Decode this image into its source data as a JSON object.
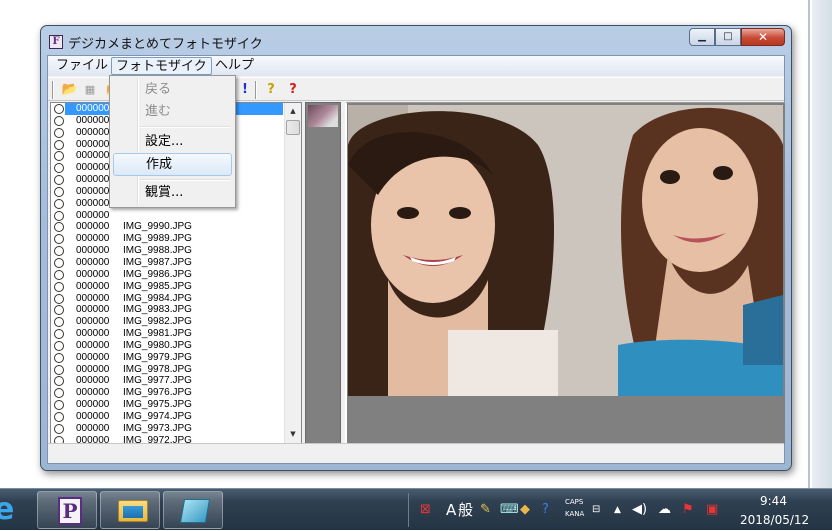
{
  "window": {
    "title": "デジカメまとめてフォトモザイク",
    "app_icon_letter": "F",
    "caption": {
      "minimize": "▁",
      "maximize": "□",
      "close": "✕"
    }
  },
  "menubar": {
    "file": "ファイル",
    "photomosaic": "フォトモザイク",
    "help": "ヘルプ"
  },
  "dropdown": {
    "back": "戻る",
    "forward": "進む",
    "settings": "設定...",
    "create": "作成",
    "view": "観賞..."
  },
  "toolbar": {
    "folder_icon": "📂",
    "film_icon": "▦",
    "excl": "!",
    "q1": "?",
    "q2": "?"
  },
  "file_list": {
    "rows": [
      {
        "num": "000000",
        "name": ""
      },
      {
        "num": "000000",
        "name": ""
      },
      {
        "num": "000000",
        "name": ""
      },
      {
        "num": "000000",
        "name": ""
      },
      {
        "num": "000000",
        "name": ""
      },
      {
        "num": "000000",
        "name": ""
      },
      {
        "num": "000000",
        "name": ""
      },
      {
        "num": "000000",
        "name": ""
      },
      {
        "num": "000000",
        "name": ""
      },
      {
        "num": "000000",
        "name": ""
      },
      {
        "num": "000000",
        "name": "IMG_9990.JPG"
      },
      {
        "num": "000000",
        "name": "IMG_9989.JPG"
      },
      {
        "num": "000000",
        "name": "IMG_9988.JPG"
      },
      {
        "num": "000000",
        "name": "IMG_9987.JPG"
      },
      {
        "num": "000000",
        "name": "IMG_9986.JPG"
      },
      {
        "num": "000000",
        "name": "IMG_9985.JPG"
      },
      {
        "num": "000000",
        "name": "IMG_9984.JPG"
      },
      {
        "num": "000000",
        "name": "IMG_9983.JPG"
      },
      {
        "num": "000000",
        "name": "IMG_9982.JPG"
      },
      {
        "num": "000000",
        "name": "IMG_9981.JPG"
      },
      {
        "num": "000000",
        "name": "IMG_9980.JPG"
      },
      {
        "num": "000000",
        "name": "IMG_9979.JPG"
      },
      {
        "num": "000000",
        "name": "IMG_9978.JPG"
      },
      {
        "num": "000000",
        "name": "IMG_9977.JPG"
      },
      {
        "num": "000000",
        "name": "IMG_9976.JPG"
      },
      {
        "num": "000000",
        "name": "IMG_9975.JPG"
      },
      {
        "num": "000000",
        "name": "IMG_9974.JPG"
      },
      {
        "num": "000000",
        "name": "IMG_9973.JPG"
      },
      {
        "num": "000000",
        "name": "IMG_9972.JPG"
      }
    ]
  },
  "taskbar": {
    "ie_glyph": "e",
    "pinned_app_letter": "P",
    "tray_a": "A",
    "tray_ime": "般",
    "caps": "CAPS",
    "kana": "KANA",
    "time": "9:44",
    "date": "2018/05/12"
  }
}
